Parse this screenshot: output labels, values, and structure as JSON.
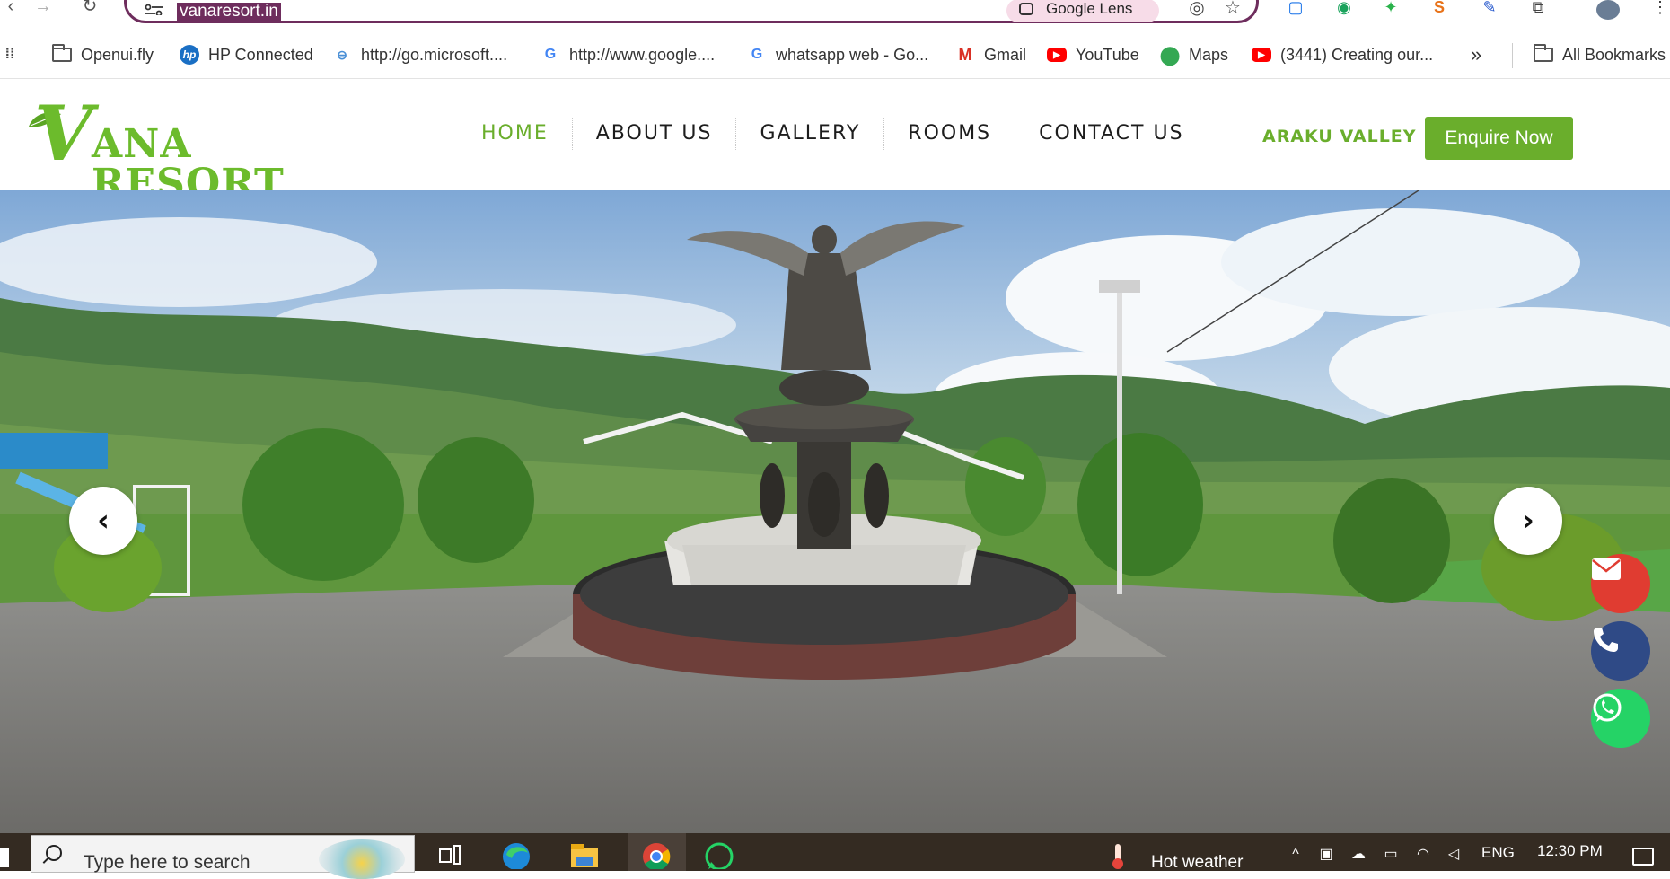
{
  "browser": {
    "url": "vanaresort.in",
    "lens_label": "Google Lens",
    "bookmarks": [
      {
        "label": "Openui.fly",
        "icon": "folder-icon"
      },
      {
        "label": "HP Connected",
        "icon": "hp-icon"
      },
      {
        "label": "http://go.microsoft....",
        "icon": "microsoft-link-icon"
      },
      {
        "label": "http://www.google....",
        "icon": "google-icon"
      },
      {
        "label": "whatsapp web - Go...",
        "icon": "google-icon"
      },
      {
        "label": "Gmail",
        "icon": "gmail-icon"
      },
      {
        "label": "YouTube",
        "icon": "youtube-icon"
      },
      {
        "label": "Maps",
        "icon": "maps-icon"
      },
      {
        "label": "(3441) Creating our...",
        "icon": "youtube-icon"
      }
    ],
    "overflow_label": "»",
    "all_bookmarks_label": "All Bookmarks"
  },
  "site": {
    "logo_initial": "V",
    "logo_rest": "ANA RESORT",
    "menu": [
      {
        "label": "HOME",
        "active": true
      },
      {
        "label": "ABOUT US",
        "active": false
      },
      {
        "label": "GALLERY",
        "active": false
      },
      {
        "label": "ROOMS",
        "active": false
      },
      {
        "label": "CONTACT US",
        "active": false
      }
    ],
    "location_label": "ARAKU VALLEY",
    "enquire_label": "Enquire Now",
    "colors": {
      "brand_green": "#6aae2c",
      "email_red": "#e03c31",
      "phone_navy": "#2f4a86",
      "whatsapp_green": "#25d366"
    }
  },
  "hero": {
    "prev_label": "‹",
    "next_label": "›",
    "floating": [
      {
        "name": "email-float-button",
        "icon": "envelope-icon"
      },
      {
        "name": "phone-float-button",
        "icon": "phone-icon"
      },
      {
        "name": "whatsapp-float-button",
        "icon": "whatsapp-icon"
      }
    ]
  },
  "taskbar": {
    "search_placeholder": "Type here to search",
    "weather_label": "Hot weather",
    "language": "ENG",
    "time": "12:30 PM"
  }
}
